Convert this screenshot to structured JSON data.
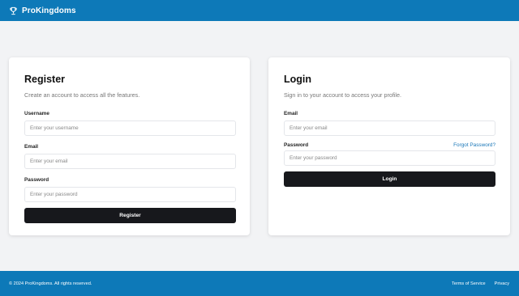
{
  "brand": {
    "name": "ProKingdoms",
    "icon": "trophy-icon"
  },
  "register": {
    "title": "Register",
    "subtitle": "Create an account to access all the features.",
    "username_label": "Username",
    "username_placeholder": "Enter your username",
    "email_label": "Email",
    "email_placeholder": "Enter your email",
    "password_label": "Password",
    "password_placeholder": "Enter your password",
    "submit_label": "Register"
  },
  "login": {
    "title": "Login",
    "subtitle": "Sign in to your account to access your profile.",
    "email_label": "Email",
    "email_placeholder": "Enter your email",
    "password_label": "Password",
    "forgot_label": "Forgot Password?",
    "password_placeholder": "Enter your password",
    "submit_label": "Login"
  },
  "footer": {
    "copyright": "© 2024 ProKingdoms. All rights reserved.",
    "links": [
      "Terms of Service",
      "Privacy"
    ]
  },
  "colors": {
    "header": "#0d79b8",
    "background": "#f2f3f5",
    "button": "#17181c",
    "link": "#1a77b8"
  }
}
